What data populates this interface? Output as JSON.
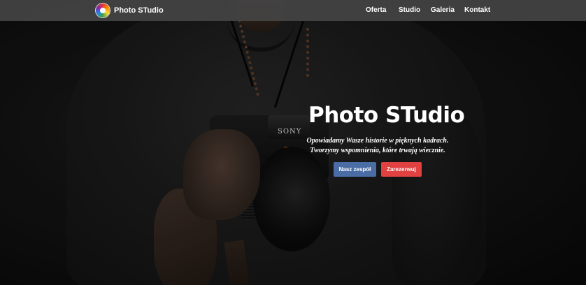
{
  "navbar": {
    "brand": "Photo STudio",
    "logo_icon": "colorful-aperture-logo",
    "links": [
      "Oferta",
      "Studio",
      "Galeria",
      "Kontakt"
    ]
  },
  "hero": {
    "title": "Photo STudio",
    "tagline_line1": "Opowiadamy Wasze historie w pięknych kadrach.",
    "tagline_line2": "Tworzymy wspomnienia, które trwają wiecznie.",
    "camera_brand": "SONY",
    "buttons": {
      "team": "Nasz zespół",
      "book": "Zarezerwuj"
    }
  },
  "colors": {
    "navbar_bg": "#444444",
    "team_button": "#4a6da6",
    "book_button": "#e24141"
  }
}
